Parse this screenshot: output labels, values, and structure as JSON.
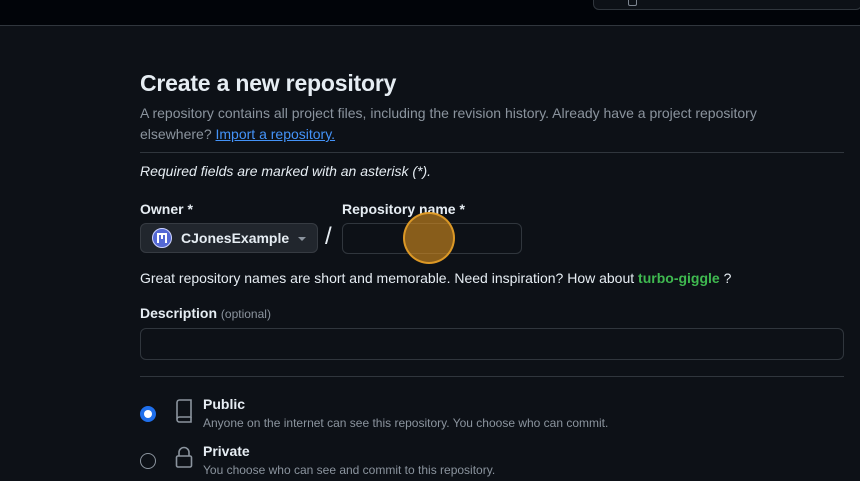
{
  "header": {
    "search_icon": "search-box-glyph"
  },
  "page": {
    "title": "Create a new repository",
    "subtitle_text": "A repository contains all project files, including the revision history. Already have a project repository elsewhere? ",
    "import_link": "Import a repository.",
    "required_note": "Required fields are marked with an asterisk (*)."
  },
  "owner": {
    "label": "Owner *",
    "selected": "CJonesExample",
    "avatar_icon": "user-avatar",
    "caret_icon": "triangle-down-icon"
  },
  "separator": "/",
  "repository_name": {
    "label": "Repository name *",
    "value": "",
    "placeholder": ""
  },
  "hint": {
    "text": "Great repository names are short and memorable. Need inspiration? How about ",
    "suggestion": "turbo-giggle",
    "suffix": " ?"
  },
  "description": {
    "label": "Description",
    "optional": "(optional)",
    "value": "",
    "placeholder": ""
  },
  "visibility": {
    "options": [
      {
        "title": "Public",
        "description": "Anyone on the internet can see this repository. You choose who can commit.",
        "icon": "repo-icon",
        "checked": true
      },
      {
        "title": "Private",
        "description": "You choose who can see and commit to this repository.",
        "icon": "lock-icon",
        "checked": false
      }
    ]
  },
  "colors": {
    "background": "#0d1117",
    "accent_blue": "#1f6feb",
    "link": "#4493f8",
    "suggestion_green": "#3fb950",
    "click_indicator": "#d58c1e"
  }
}
